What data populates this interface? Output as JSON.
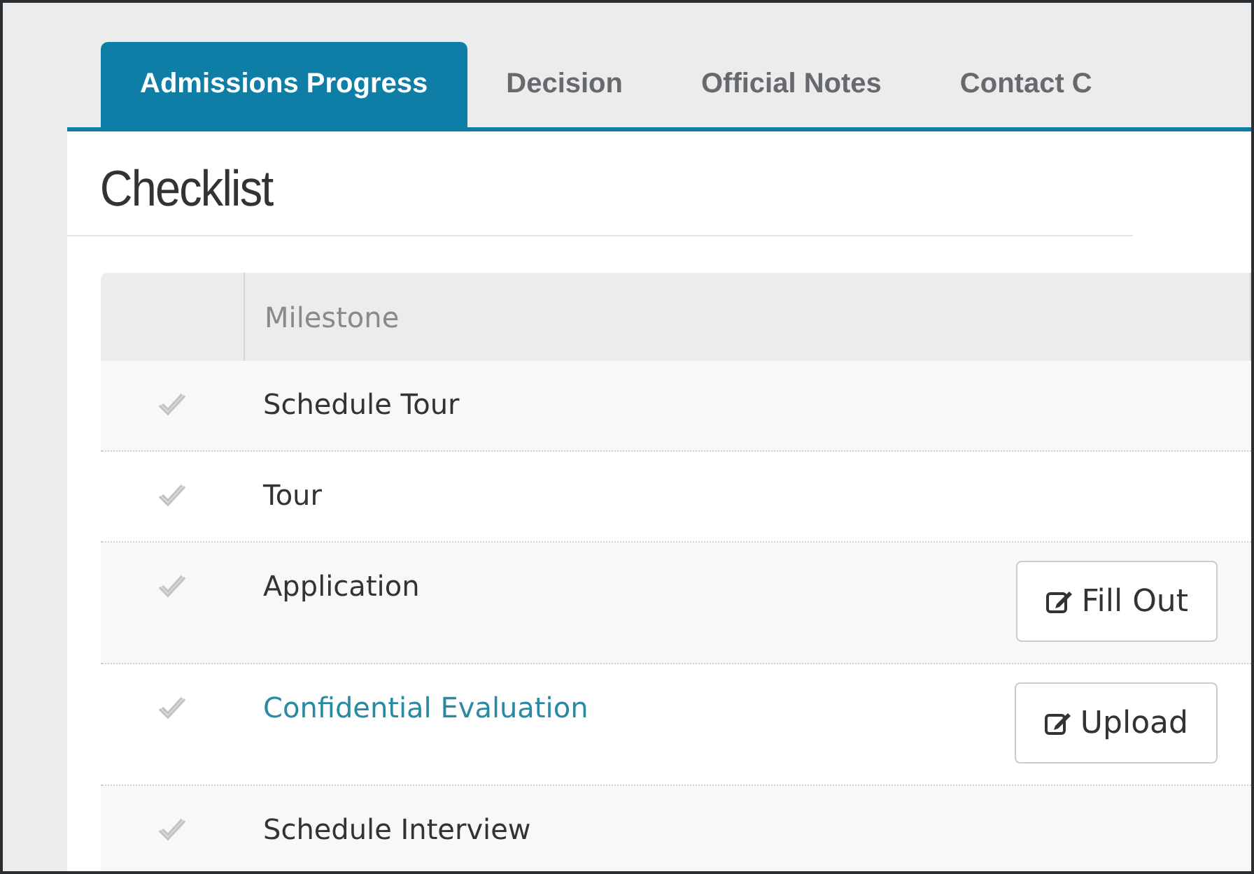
{
  "tabs": [
    {
      "label": "Admissions Progress",
      "selected": true
    },
    {
      "label": "Decision",
      "selected": false
    },
    {
      "label": "Official Notes",
      "selected": false
    },
    {
      "label": "Contact C",
      "selected": false
    }
  ],
  "panel": {
    "title": "Checklist"
  },
  "table": {
    "columns": [
      "Milestone"
    ],
    "rows": [
      {
        "milestone": "Schedule Tour",
        "kind": "text"
      },
      {
        "milestone": "Tour",
        "kind": "text"
      },
      {
        "milestone": "Application",
        "kind": "text",
        "action": "Fill Out"
      },
      {
        "milestone": "Confidential Evaluation",
        "kind": "link",
        "action": "Upload"
      },
      {
        "milestone": "Schedule Interview",
        "kind": "text"
      }
    ]
  }
}
